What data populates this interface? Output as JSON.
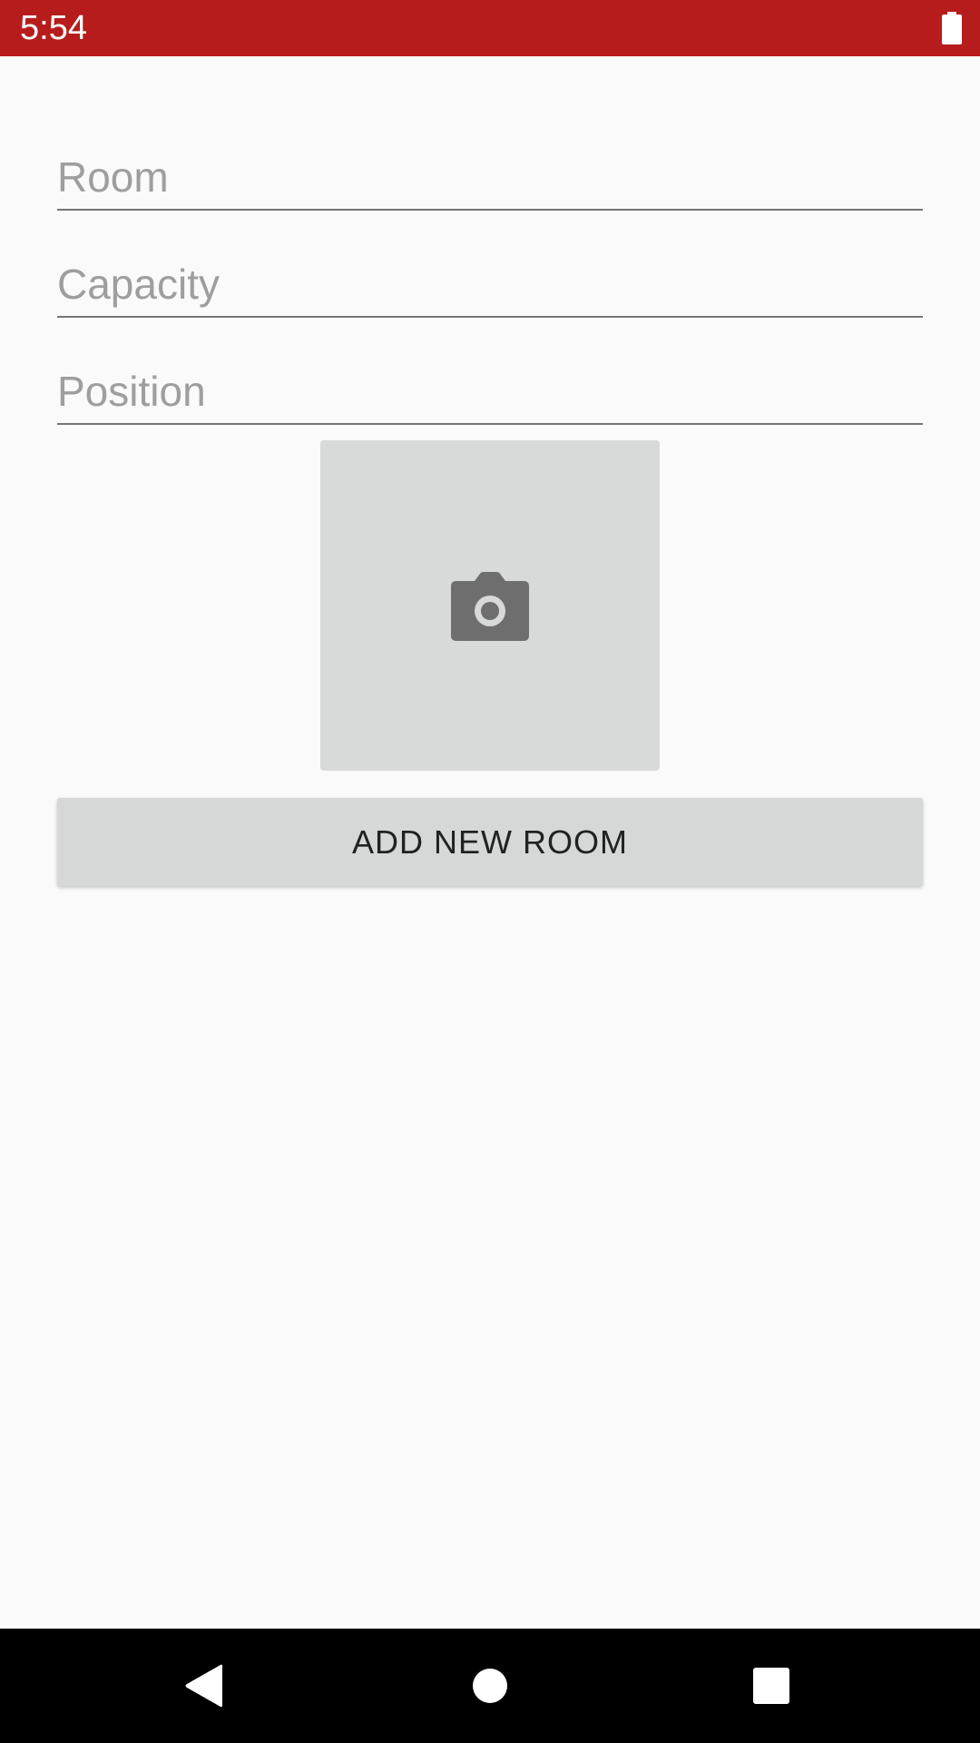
{
  "status_bar": {
    "time": "5:54",
    "battery_icon": "battery-full-icon",
    "background_color": "#b71c1c"
  },
  "form": {
    "room_placeholder": "Room",
    "capacity_placeholder": "Capacity",
    "position_placeholder": "Position",
    "room_value": "",
    "capacity_value": "",
    "position_value": "",
    "photo_icon": "camera-icon",
    "add_button_label": "ADD NEW ROOM"
  },
  "nav_bar": {
    "back_icon": "back-triangle-icon",
    "home_icon": "home-circle-icon",
    "recents_icon": "recents-square-icon"
  }
}
